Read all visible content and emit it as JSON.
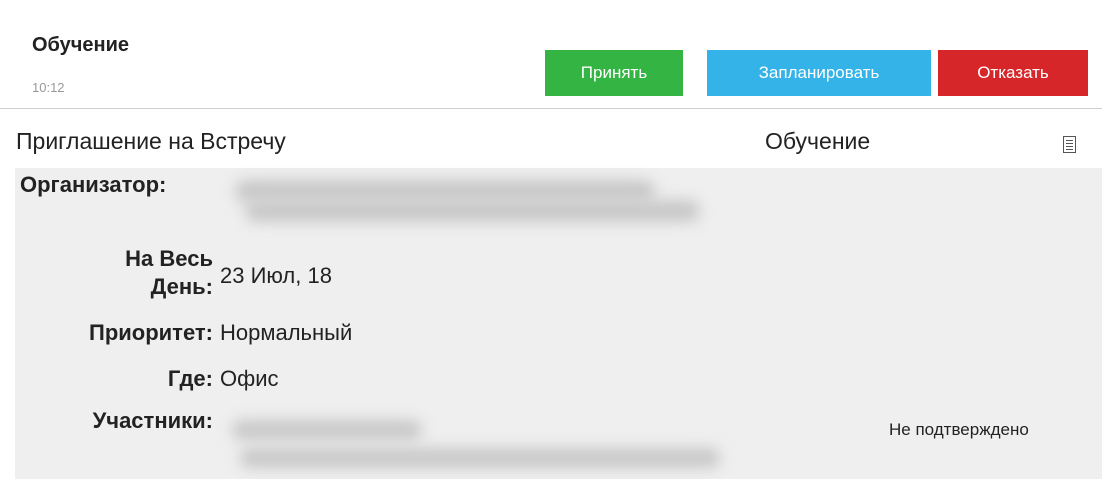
{
  "header": {
    "subject": "Обучение",
    "time": "10:12",
    "buttons": {
      "accept": "Принять",
      "schedule": "Запланировать",
      "decline": "Отказать"
    }
  },
  "invite": {
    "type_title": "Приглашение на Встречу",
    "subject": "Обучение",
    "icon": "attachment-icon"
  },
  "details": {
    "organizer_label": "Организатор:",
    "all_day_label_line1": "На Весь",
    "all_day_label_line2": "День:",
    "all_day_value": "23 Июл, 18",
    "priority_label": "Приоритет:",
    "priority_value": "Нормальный",
    "location_label": "Где:",
    "location_value": "Офис",
    "attendees_label": "Участники:",
    "attendee_status": "Не подтверждено"
  },
  "colors": {
    "accept": "#33b443",
    "schedule": "#34b3e8",
    "decline": "#d62629",
    "details_bg": "#efefef"
  }
}
